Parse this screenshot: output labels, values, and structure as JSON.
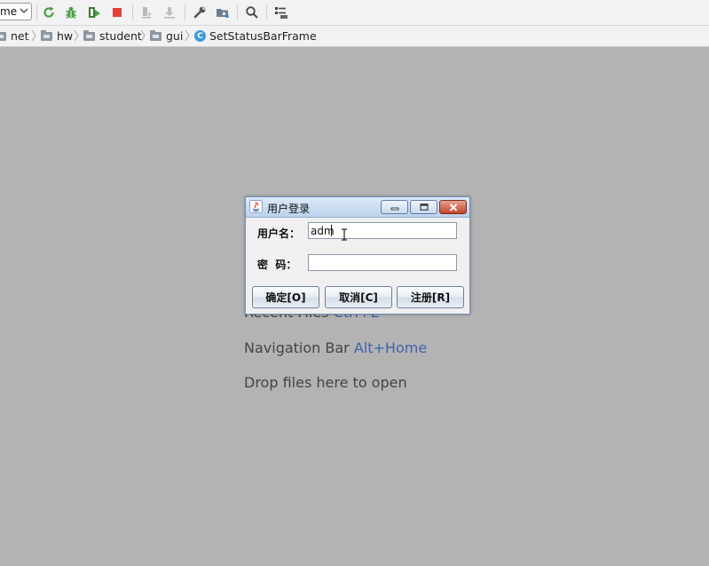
{
  "toolbar": {
    "run_config_value": "me",
    "icons": [
      "rerun-icon",
      "debug-icon",
      "coverage-icon",
      "stop-icon",
      "build-icon",
      "deploy-icon",
      "settings-wrench-icon",
      "project-structure-icon",
      "search-icon",
      "sdk-manager-icon"
    ]
  },
  "breadcrumb": {
    "items": [
      "net",
      "hw",
      "student",
      "gui"
    ],
    "class_badge": "C",
    "class_name": "SetStatusBarFrame"
  },
  "editor": {
    "recent_files_label": "Recent Files",
    "recent_files_key": "Ctrl+E",
    "navigation_bar_label": "Navigation Bar",
    "navigation_bar_key": "Alt+Home",
    "drop_files_label": "Drop files here to open"
  },
  "dialog": {
    "title": "用户登录",
    "username_label": "用户名：",
    "username_value": "adm",
    "password_label": "密  码：",
    "password_value": "",
    "ok_button": "确定[O]",
    "cancel_button": "取消[C]",
    "register_button": "注册[R]"
  },
  "colors": {
    "workspace_bg": "#b3b3b3",
    "shortcut_key": "#3f63a8",
    "stop_red": "#e0433a",
    "run_green": "#4aa148"
  }
}
